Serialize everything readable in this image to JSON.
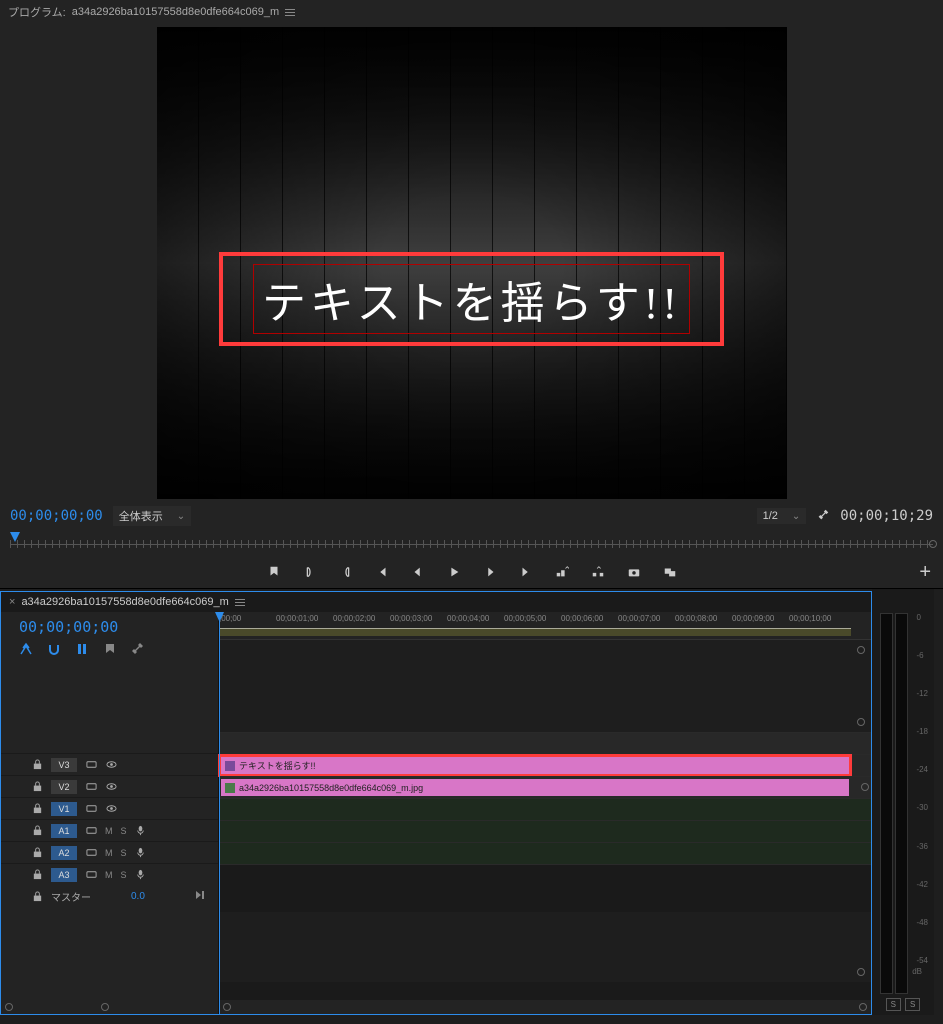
{
  "program": {
    "title_prefix": "プログラム:",
    "sequence_name": "a34a2926ba10157558d8e0dfe664c069_m",
    "overlay_text": "テキストを揺らす!!",
    "timecode_left": "00;00;00;00",
    "zoom_label": "全体表示",
    "resolution_label": "1/2",
    "timecode_right": "00;00;10;29"
  },
  "transport": {
    "icons": [
      "marker",
      "in",
      "out",
      "go-in",
      "step-back",
      "play",
      "step-fwd",
      "go-out",
      "lift",
      "extract",
      "snapshot",
      "export"
    ]
  },
  "timeline": {
    "sequence_name": "a34a2926ba10157558d8e0dfe664c069_m",
    "timecode": "00;00;00;00",
    "ruler_labels": [
      ";00;00",
      "00;00;01;00",
      "00;00;02;00",
      "00;00;03;00",
      "00;00;04;00",
      "00;00;05;00",
      "00;00;06;00",
      "00;00;07;00",
      "00;00;08;00",
      "00;00;09;00",
      "00;00;10;00"
    ],
    "video_tracks": [
      {
        "label": "V3"
      },
      {
        "label": "V2"
      },
      {
        "label": "V1"
      }
    ],
    "audio_tracks": [
      {
        "label": "A1",
        "m": "M",
        "s": "S"
      },
      {
        "label": "A2",
        "m": "M",
        "s": "S"
      },
      {
        "label": "A3",
        "m": "M",
        "s": "S"
      }
    ],
    "master_label": "マスター",
    "master_value": "0.0",
    "clips": {
      "v2": "テキストを揺らす!!",
      "v1": "a34a2926ba10157558d8e0dfe664c069_m.jpg"
    }
  },
  "meters": {
    "scale": [
      "0",
      "-6",
      "-12",
      "-18",
      "-24",
      "-30",
      "-36",
      "-42",
      "-48",
      "-54",
      ""
    ],
    "db": "dB",
    "solo": [
      "S",
      "S"
    ]
  }
}
